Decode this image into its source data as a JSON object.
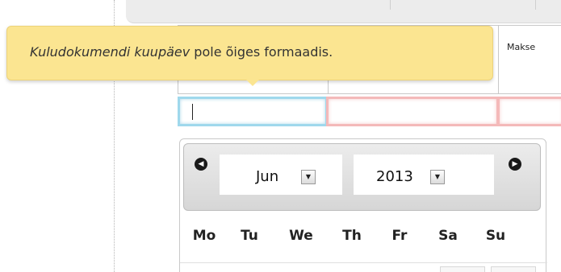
{
  "tooltip": {
    "field_name": "Kuludokumendi kuupäev",
    "message": " pole õiges formaadis."
  },
  "grid": {
    "columns": [
      {
        "label": ""
      },
      {
        "label": ""
      },
      {
        "label": "Makse"
      }
    ],
    "invalid_fields": [
      "",
      ""
    ]
  },
  "datepicker": {
    "prev_icon": "circle-left-arrow-icon",
    "next_icon": "circle-right-arrow-icon",
    "month_value": "Jun",
    "year_value": "2013",
    "weekdays": [
      "Mo",
      "Tu",
      "We",
      "Th",
      "Fr",
      "Sa",
      "Su"
    ]
  },
  "colors": {
    "tooltip_bg": "#fbe591",
    "focus_border": "#9fd8ec",
    "invalid_border": "#f4b9b9"
  }
}
